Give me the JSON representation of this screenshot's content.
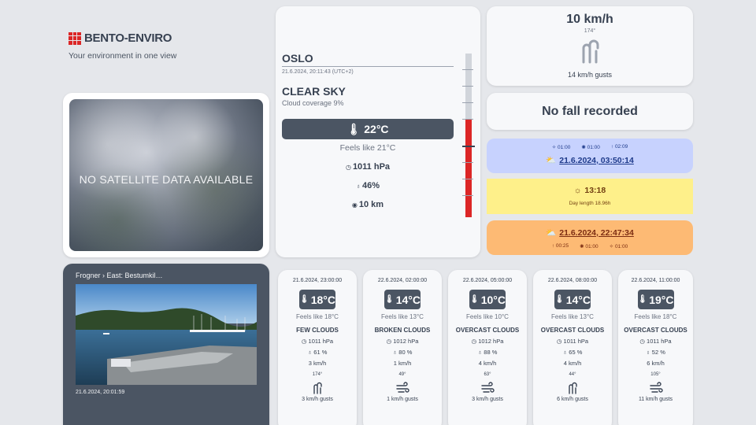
{
  "brand": {
    "name": "BENTO-ENVIRO",
    "tagline": "Your environment in one view"
  },
  "satellite": {
    "message": "NO SATELLITE DATA AVAILABLE"
  },
  "current": {
    "city": "OSLO",
    "datetime": "21.6.2024, 20:11:43 (UTC+2)",
    "sky": "CLEAR SKY",
    "coverage": "Cloud coverage 9%",
    "temperature": "22°C",
    "feels_like": "Feels like 21°C",
    "pressure": "1011 hPa",
    "humidity": "46%",
    "visibility": "10 km",
    "thermometer_fill": 0.6
  },
  "wind": {
    "speed": "10 km/h",
    "direction": "174°",
    "gusts": "14 km/h gusts"
  },
  "precipitation": {
    "text": "No fall recorded"
  },
  "sun": {
    "sunrise_small": [
      "01:00",
      "01:00",
      "02:09"
    ],
    "sunrise": "21.6.2024, 03:50:14",
    "solar_noon": "13:18",
    "day_length": "Day length 18.96h",
    "sunset": "21.6.2024, 22:47:34",
    "sunset_small": [
      "00:25",
      "01:00",
      "01:00"
    ]
  },
  "webcam": {
    "title": "Frogner › East: Bestumkil…",
    "timestamp": "21.6.2024, 20:01:59"
  },
  "forecast": [
    {
      "time": "21.6.2024, 23:00:00",
      "temp": "18°C",
      "feels": "Feels like 18°C",
      "desc": "FEW CLOUDS",
      "pressure": "1011 hPa",
      "humidity": "61 %",
      "wind": "3 km/h",
      "deg": "174°",
      "gusts": "3 km/h gusts"
    },
    {
      "time": "22.6.2024, 02:00:00",
      "temp": "14°C",
      "feels": "Feels like 13°C",
      "desc": "BROKEN CLOUDS",
      "pressure": "1012 hPa",
      "humidity": "80 %",
      "wind": "1 km/h",
      "deg": "49°",
      "gusts": "1 km/h gusts"
    },
    {
      "time": "22.6.2024, 05:00:00",
      "temp": "10°C",
      "feels": "Feels like 10°C",
      "desc": "OVERCAST CLOUDS",
      "pressure": "1012 hPa",
      "humidity": "88 %",
      "wind": "4 km/h",
      "deg": "63°",
      "gusts": "3 km/h gusts"
    },
    {
      "time": "22.6.2024, 08:00:00",
      "temp": "14°C",
      "feels": "Feels like 13°C",
      "desc": "OVERCAST CLOUDS",
      "pressure": "1011 hPa",
      "humidity": "65 %",
      "wind": "4 km/h",
      "deg": "44°",
      "gusts": "6 km/h gusts"
    },
    {
      "time": "22.6.2024, 11:00:00",
      "temp": "19°C",
      "feels": "Feels like 18°C",
      "desc": "OVERCAST CLOUDS",
      "pressure": "1011 hPa",
      "humidity": "52 %",
      "wind": "6 km/h",
      "deg": "105°",
      "gusts": "11 km/h gusts"
    }
  ]
}
